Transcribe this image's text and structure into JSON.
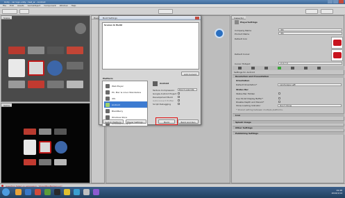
{
  "window": {
    "title": "Unity - car logo.unity - test_ar - Android",
    "menu": [
      "File",
      "Edit",
      "Assets",
      "GameObject",
      "Component",
      "Window",
      "Help"
    ]
  },
  "panels": {
    "scene_tab": "Scene",
    "game_tab": "Game",
    "hierarchy_tab": "Hierarchy",
    "project_tab": "Project",
    "inspector_tab": "Inspector"
  },
  "build_dialog": {
    "title": "Build Settings",
    "scenes_header": "Scenes In Build",
    "add_current": "Add Current",
    "platform_header": "Platform",
    "platforms": [
      {
        "label": "Web Player",
        "selected": false
      },
      {
        "label": "PC, Mac & Linux Standalone",
        "selected": false
      },
      {
        "label": "iOS",
        "selected": false
      },
      {
        "label": "Android",
        "selected": true
      },
      {
        "label": "BlackBerry",
        "selected": false
      },
      {
        "label": "Windows Store",
        "selected": false
      },
      {
        "label": "Windows Phone 8",
        "selected": false
      }
    ],
    "right_platform_title": "Android",
    "options": [
      {
        "label": "Texture Compression",
        "value": "Don't override"
      },
      {
        "label": "Google Android Project",
        "value": ""
      },
      {
        "label": "Development Build",
        "value": ""
      },
      {
        "label": "Autoconnect Profiler",
        "value": ""
      },
      {
        "label": "Script Debugging",
        "value": ""
      }
    ],
    "switch_platform": "Switch Platform",
    "player_settings": "Player Settings...",
    "build": "Build",
    "build_and_run": "Build And Run"
  },
  "inspector": {
    "title": "PlayerSettings",
    "fields": [
      {
        "label": "Company Name",
        "value": "dtn"
      },
      {
        "label": "Product Name",
        "value": "dtn"
      },
      {
        "label": "Default Icon",
        "value": ""
      },
      {
        "label": "Default Cursor",
        "value": ""
      },
      {
        "label": "Cursor Hotspot",
        "value": "X 0   Y 0"
      }
    ],
    "settings_for": "Settings for Android",
    "resolution_section": "Resolution and Presentation",
    "orientation_header": "Orientation",
    "default_orientation_label": "Default Orientation*",
    "default_orientation_value": "Landscape Left",
    "status_bar_header": "Status Bar",
    "status_bar_hidden": "Status Bar Hidden",
    "use32bit": "Use 32-bit Display Buffer*",
    "disable_depth": "Disable Depth and Stencil*",
    "show_loading": "Show Loading Indicator",
    "show_loading_value": "Don't Show",
    "note": "* Shared setting between multiple platforms.",
    "sections": [
      "Icon",
      "Splash Image",
      "Other Settings",
      "Publishing Settings"
    ]
  },
  "status": {
    "message": "Assertion failed on expression: 'ShouldRunBehaviour()'"
  },
  "taskbar": {
    "time": "19:48",
    "date": "2016/1/14"
  },
  "colors": {
    "selection": "#3d7bd1",
    "highlight_box": "#e01010",
    "taskbar": "#2c4d72"
  }
}
